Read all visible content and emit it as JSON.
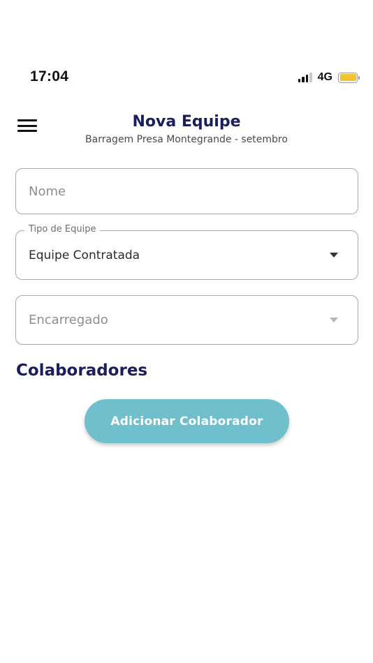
{
  "status_bar": {
    "time": "17:04",
    "network": "4G",
    "battery_color": "#f4c430"
  },
  "header": {
    "menu_icon": "hamburger-menu-icon",
    "title": "Nova Equipe",
    "subtitle": "Barragem Presa Montegrande - setembro"
  },
  "form": {
    "name": {
      "placeholder": "Nome",
      "value": ""
    },
    "team_type": {
      "label": "Tipo de Equipe",
      "value": "Equipe Contratada"
    },
    "manager": {
      "placeholder": "Encarregado"
    }
  },
  "collaborators": {
    "title": "Colaboradores",
    "add_button_label": "Adicionar Colaborador",
    "button_color": "#6fbfcc"
  },
  "colors": {
    "title": "#1b1d5c",
    "field_border": "#a8a8a8"
  }
}
